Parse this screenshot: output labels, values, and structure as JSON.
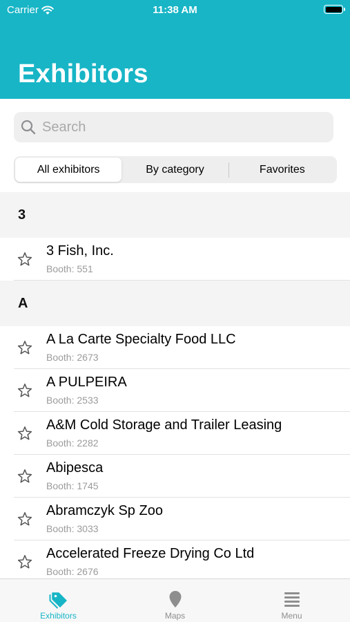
{
  "status_bar": {
    "carrier": "Carrier",
    "time": "11:38 AM",
    "battery_level": 1.0
  },
  "header": {
    "title": "Exhibitors"
  },
  "search": {
    "placeholder": "Search"
  },
  "segments": {
    "all": "All exhibitors",
    "category": "By category",
    "favorites": "Favorites",
    "selected": "All exhibitors"
  },
  "sections": [
    {
      "letter": "3",
      "items": [
        {
          "name": "3 Fish, Inc.",
          "booth": "Booth: 551"
        }
      ]
    },
    {
      "letter": "A",
      "items": [
        {
          "name": "A La Carte Specialty Food LLC",
          "booth": "Booth: 2673"
        },
        {
          "name": "A PULPEIRA",
          "booth": "Booth: 2533"
        },
        {
          "name": "A&M Cold Storage and Trailer Leasing",
          "booth": "Booth: 2282"
        },
        {
          "name": "Abipesca",
          "booth": "Booth: 1745"
        },
        {
          "name": "Abramczyk Sp Zoo",
          "booth": "Booth: 3033"
        },
        {
          "name": "Accelerated Freeze Drying Co Ltd",
          "booth": "Booth: 2676"
        }
      ]
    }
  ],
  "tabbar": {
    "exhibitors": "Exhibitors",
    "maps": "Maps",
    "menu": "Menu",
    "active": "Exhibitors"
  },
  "colors": {
    "accent": "#17b5c6",
    "inactive_tab": "#8e8e8e"
  },
  "icons": {
    "wifi": "wifi-icon",
    "battery": "battery-icon",
    "search": "search-icon",
    "star": "star-outline-icon",
    "exhibitors": "tag-icon",
    "maps": "map-pin-icon",
    "menu": "hamburger-menu-icon"
  }
}
